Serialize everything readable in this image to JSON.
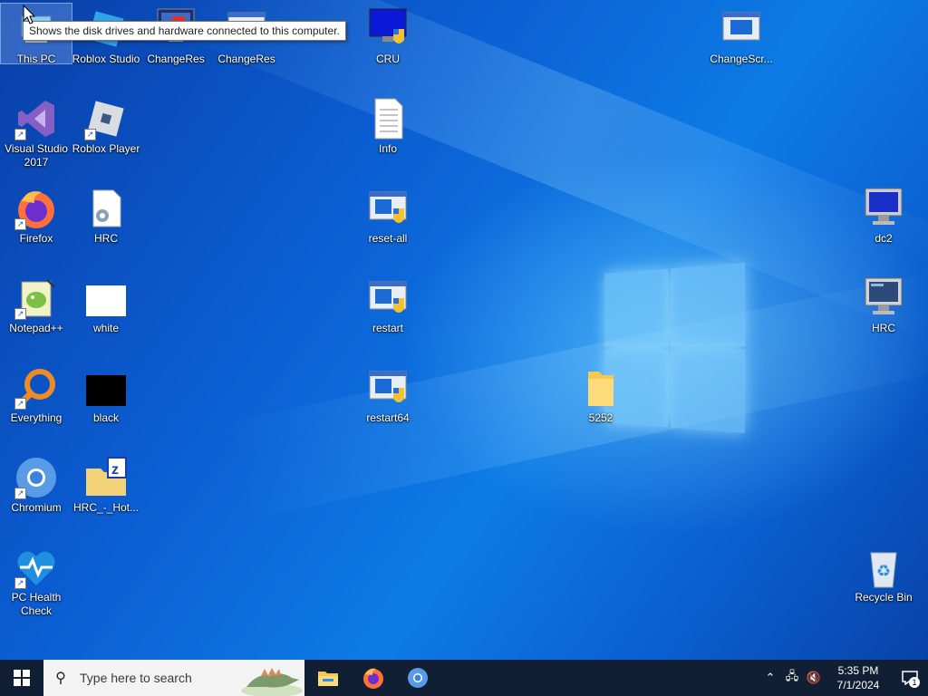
{
  "tooltip": "Shows the disk drives and hardware connected to this computer.",
  "icons": {
    "this_pc": "This PC",
    "roblox_studio": "Roblox Studio",
    "changeres1": "ChangeRes",
    "changeres2": "ChangeRes",
    "cru": "CRU",
    "changescr": "ChangeScr...",
    "visual_studio": "Visual Studio 2017",
    "roblox_player": "Roblox Player",
    "info": "Info",
    "firefox": "Firefox",
    "hrc_file": "HRC",
    "reset_all": "reset-all",
    "dc2": "dc2",
    "notepadpp": "Notepad++",
    "white": "white",
    "restart": "restart",
    "hrc_computer": "HRC",
    "everything": "Everything",
    "black": "black",
    "restart64": "restart64",
    "folder_5252": "5252",
    "chromium": "Chromium",
    "hrc_zip": "HRC_-_Hot...",
    "pc_health": "PC Health Check",
    "recycle_bin": "Recycle Bin"
  },
  "taskbar": {
    "search_placeholder": "Type here to search",
    "time": "5:35 PM",
    "date": "7/1/2024",
    "notification_count": "1"
  },
  "colors": {
    "taskbar": "#101f33",
    "desktop_accent": "#0b5ed3"
  }
}
